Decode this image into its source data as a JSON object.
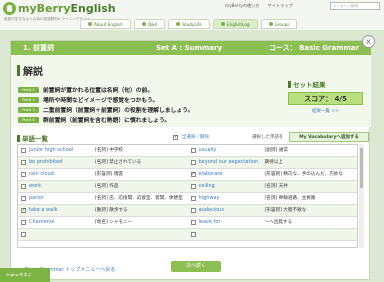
{
  "site": {
    "logo": "myBerry",
    "logo_sub": "English",
    "tagline": "英語が苦手な大人の為の英語教材e-ラーニングサイト",
    "links": [
      "myBerryの使い方",
      "サイトマップ"
    ],
    "search_placeholder": "メッセージ検索"
  },
  "nav": [
    "About English",
    "Q&A",
    "StudyLife",
    "EnglishLog",
    "Groups"
  ],
  "lesson": {
    "unit": "1. 前置詞",
    "set": "Set A : Summary",
    "course": "コース： Basic Grammar"
  },
  "explanation": {
    "title": "解説",
    "points": [
      {
        "badge": "Point 1",
        "text": "前置詞が置かれる位置は名詞（句）の前。"
      },
      {
        "badge": "Point 2",
        "text": "場所や時間などイメージで感覚をつかもう。"
      },
      {
        "badge": "Point 3",
        "text": "二重前置詞（前置詞＋前置詞）の役割を理解しましょう。"
      },
      {
        "badge": "Point 4",
        "text": "群前置詞（前置詞を含む熟語）に慣れましょう。"
      }
    ]
  },
  "result": {
    "title": "セット結果",
    "score": "スコア： 4/5",
    "link": "結果一覧 >>"
  },
  "wordlist": {
    "title": "単語一覧",
    "all_check": "全選択／解除",
    "selected_label": "選択した単語を",
    "add_button": "My Vocabularyへ追加する",
    "rows": [
      [
        {
          "word": "junior high school",
          "meaning": "[名詞] 中学校",
          "checked": false
        },
        {
          "word": "usually",
          "meaning": "[副詞] 通常",
          "checked": false
        }
      ],
      [
        {
          "word": "be prohibited",
          "meaning": "[名詞] 禁止されている",
          "checked": false
        },
        {
          "word": "beyond our expectation",
          "meaning": "期待以上",
          "checked": false
        }
      ],
      [
        {
          "word": "rain cloud",
          "meaning": "[形容詞] 雨雲",
          "checked": false
        },
        {
          "word": "elaborate",
          "meaning": "[形容詞] 精巧な、手の込んだ、巧妙な",
          "checked": true
        }
      ],
      [
        {
          "word": "work",
          "meaning": "[名詞] 作品",
          "checked": false
        },
        {
          "word": "ceiling",
          "meaning": "[名詞] 天井",
          "checked": false
        }
      ],
      [
        {
          "word": "parlor",
          "meaning": "[名詞] 店、応接間、応接室、客間、休憩室",
          "checked": false
        },
        {
          "word": "highway",
          "meaning": "[名詞] 幹線道路、主要路",
          "checked": false
        }
      ],
      [
        {
          "word": "take a walk",
          "meaning": "[動詞] 散歩する",
          "checked": true
        },
        {
          "word": "audacious",
          "meaning": "[形容詞] 大胆不敵な",
          "checked": false
        }
      ],
      [
        {
          "word": "Chamonix",
          "meaning": "[地名] シャモニー",
          "checked": false
        },
        {
          "word": "leave for",
          "meaning": "〜へ出発する",
          "checked": false
        }
      ],
      [
        {
          "word": "",
          "meaning": "",
          "checked": false
        },
        {
          "word": "",
          "meaning": "",
          "checked": false
        }
      ]
    ]
  },
  "footer": {
    "back_link": "Basic Grammar トップメニューへ戻る",
    "next_button": "次へ続く",
    "side_tab": "Englishを学ぶ"
  }
}
